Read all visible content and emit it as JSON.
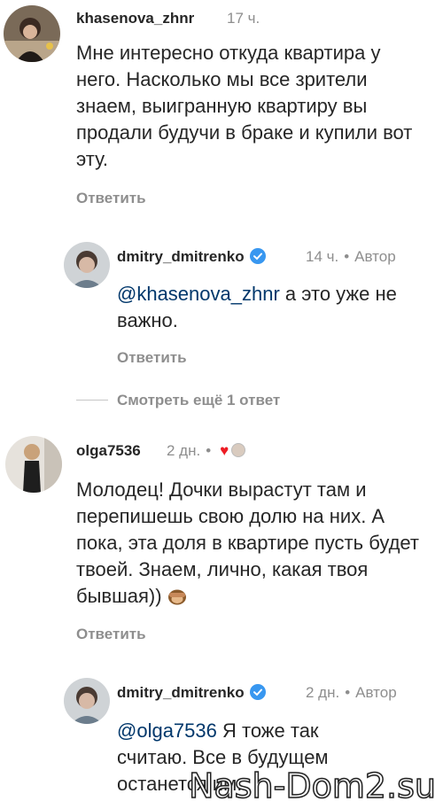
{
  "comments": [
    {
      "username": "khasenova_zhnr",
      "time": "17 ч.",
      "text": "Мне интересно откуда квартира у него. Насколько мы все зрители знаем, выигранную квартиру вы продали будучи в браке и купили вот эту.",
      "reply_label": "Ответить"
    },
    {
      "username": "dmitry_dmitrenko",
      "time": "14 ч.",
      "author_label": "Автор",
      "mention": "@khasenova_zhnr",
      "text": " а это уже не важно.",
      "reply_label": "Ответить"
    },
    {
      "username": "olga7536",
      "time": "2 дн.",
      "text": "Молодец! Дочки вырастут там и перепишешь свою долю на них. А пока, эта доля в квартире пусть будет твоей.  Знаем, лично, какая твоя бывшая))",
      "reply_label": "Ответить"
    },
    {
      "username": "dmitry_dmitrenko",
      "time": "2 дн.",
      "author_label": "Автор",
      "mention": "@olga7536",
      "text": " Я тоже так считаю. Все в будущем останется им."
    }
  ],
  "view_more_replies": "Смотреть ещё 1 ответ",
  "watermark": "Nash-Dom2.su",
  "colors": {
    "verified": "#3897f0",
    "heart": "#ed1c24",
    "mention": "#00376b"
  }
}
